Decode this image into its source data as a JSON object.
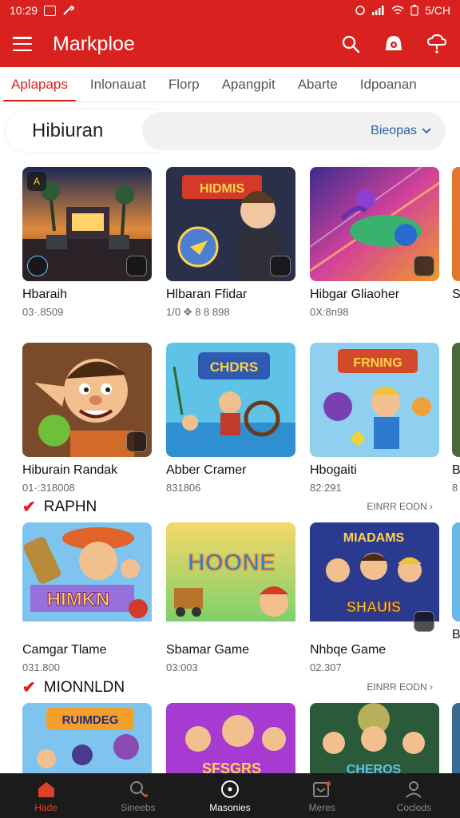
{
  "status_bar": {
    "time": "10:29",
    "battery": "5/CH"
  },
  "app_bar": {
    "title": "Markploe",
    "icons": [
      "menu-icon",
      "search-icon",
      "bell-icon",
      "cloud-alert-icon"
    ]
  },
  "tabs": [
    {
      "label": "Aplapaps",
      "active": true
    },
    {
      "label": "Inlonauat",
      "active": false
    },
    {
      "label": "Florp",
      "active": false
    },
    {
      "label": "Apangpit",
      "active": false
    },
    {
      "label": "Abarte",
      "active": false
    },
    {
      "label": "Idpoanan",
      "active": false
    }
  ],
  "header": {
    "title": "Hibiuran",
    "filter_label": "Bieopas"
  },
  "row1": [
    {
      "title": "Hbaraih",
      "meta": "03·.8509"
    },
    {
      "title": "Hlbaran Ffidar",
      "meta": "1/0 ✥ 8 8 898"
    },
    {
      "title": "Hibgar Gliaoher",
      "meta": "0X:8n98"
    },
    {
      "title": "S",
      "meta": ""
    }
  ],
  "row2": [
    {
      "title": "Hiburain Randak",
      "meta": "01·:318008"
    },
    {
      "title": "Abber Cramer",
      "meta": "831806"
    },
    {
      "title": "Hbogaiti",
      "meta": "82:291"
    },
    {
      "title": "B",
      "meta": "8"
    }
  ],
  "section1": {
    "title": "RAPHN",
    "see_all": "EINRR EODN",
    "see_all_arrow": "›"
  },
  "row3": [
    {
      "title": "Camgar Tlame",
      "meta": "031.800"
    },
    {
      "title": "Sbamar Game",
      "meta": "03:003"
    },
    {
      "title": "Nhbqe Game",
      "meta": "02.307"
    },
    {
      "title": "B",
      "meta": ""
    }
  ],
  "section2": {
    "title": "MIONNLDN",
    "see_all": "EINRR EODN",
    "see_all_arrow": "›"
  },
  "thumb_texts": {
    "r1c2": "HIDMIS",
    "r2c2": "CHDRS",
    "r2c3": "FRNING",
    "r3c1": "HIMKN",
    "r3c2": "HOONE",
    "r3c3_top": "MIADAMS",
    "r3c3_bottom": "SHAUIS",
    "r4c1": "RUIMDEG",
    "r4c2": "SFSGRS",
    "r4c3": "CHEROS"
  },
  "bottom_nav": [
    {
      "label": "Hade",
      "icon": "home-icon",
      "state": "active"
    },
    {
      "label": "Sineebs",
      "icon": "search-icon",
      "state": "normal"
    },
    {
      "label": "Masonies",
      "icon": "compass-icon",
      "state": "current"
    },
    {
      "label": "Meres",
      "icon": "inbox-icon",
      "state": "normal"
    },
    {
      "label": "Coclods",
      "icon": "profile-icon",
      "state": "normal"
    }
  ],
  "colors": {
    "brand": "#d92220",
    "link": "#2f5fa8",
    "nav_bg": "#1b1b1b"
  }
}
